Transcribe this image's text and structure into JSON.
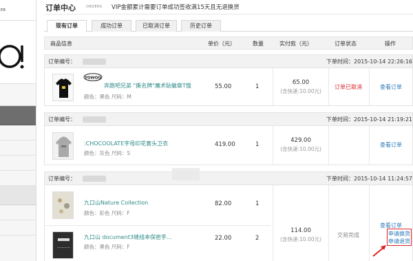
{
  "sidebar": {
    "top_label": "ER"
  },
  "header": {
    "title": "订单中心",
    "title_en": "ORDERS",
    "notice": "VIP金额累计需要订单成功签收满15天且无退换货"
  },
  "tabs": [
    {
      "label": "现有订单",
      "active": true
    },
    {
      "label": "成功订单",
      "active": false
    },
    {
      "label": "已取消订单",
      "active": false
    },
    {
      "label": "历史订单",
      "active": false
    }
  ],
  "columns": {
    "product": "商品信息",
    "price": "单价（元）",
    "qty": "数量",
    "paid": "实付款（元）",
    "status": "订单状态",
    "action": "操作"
  },
  "orders": [
    {
      "number_label": "订单编号：",
      "time": "下单时间：2015-10-14 22:26:16",
      "items": [
        {
          "name": "奔跑吧兄弟 \"撕名牌\"魔术贴徽章T恤",
          "attrs": "颜色：黑色 尺码：M",
          "price": "55.00",
          "qty": "1"
        }
      ],
      "total": "65.00",
      "shipping": "(含快递:10.00元)",
      "status": "订单已取消",
      "actions": [
        "查看订单"
      ]
    },
    {
      "number_label": "订单编号：",
      "time": "下单时间：2015-10-14 21:19:21",
      "items": [
        {
          "name": ":CHOCOOLATE字母印花套头卫衣",
          "attrs": "颜色：灰色 尺码：S",
          "price": "419.00",
          "qty": "1"
        }
      ],
      "total": "429.00",
      "shipping": "(含快递:10.00元)",
      "status": "",
      "actions": [
        "查看订单"
      ]
    },
    {
      "number_label": "订单编号：",
      "time": "下单时间：2015-10-14 11:24:57",
      "items": [
        {
          "name": "九口山Nature Collection",
          "attrs": "颜色：彩色 尺码：F",
          "price": "82.00",
          "qty": "1"
        },
        {
          "name": "九口山 document3缝线本保密手...",
          "attrs": "颜色：黑色 尺码：F",
          "price": "22.00",
          "qty": "2"
        }
      ],
      "total": "114.00",
      "shipping": "(含快递:10.00元)",
      "status": "交易完成",
      "actions": [
        "查看订单",
        "申请换货",
        "申请退货"
      ]
    }
  ],
  "colors": {
    "link": "#2a78b8",
    "product_link": "#2a8a86",
    "cancelled": "#d9232c",
    "highlight": "#e02020"
  }
}
